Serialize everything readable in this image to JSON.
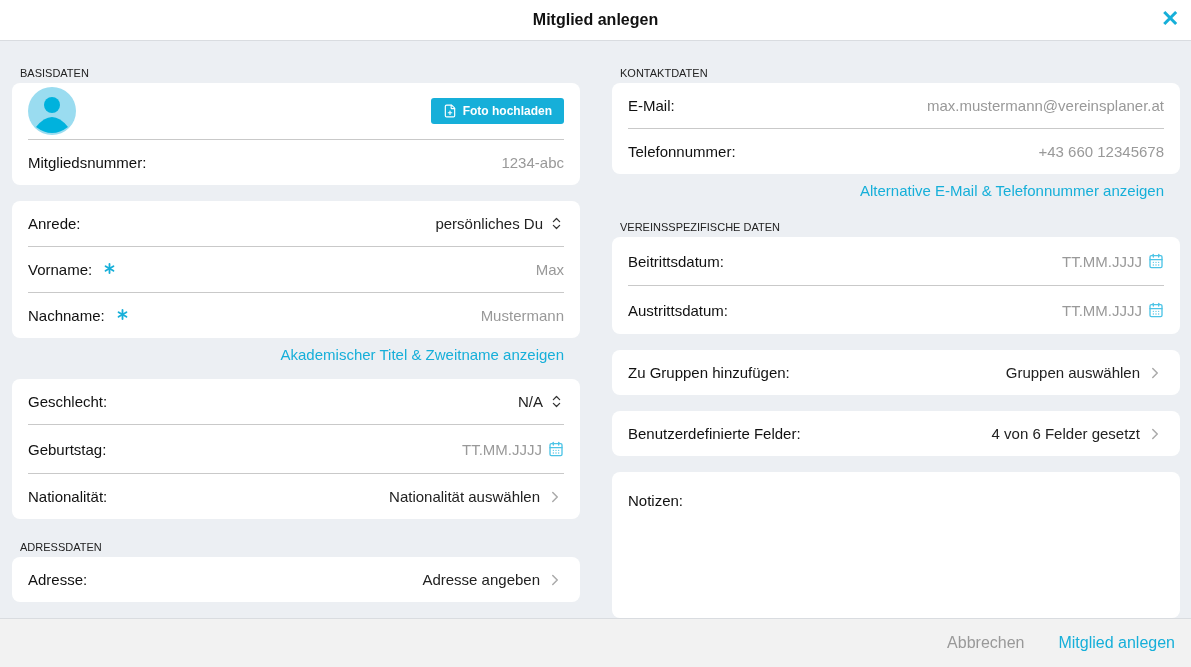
{
  "dialog": {
    "title": "Mitglied anlegen",
    "close": "✕"
  },
  "columns": [
    [
      {
        "kind": "heading",
        "text": "BASISDATEN"
      },
      {
        "kind": "card",
        "rows": [
          {
            "kind": "photo",
            "button": "Foto hochladen"
          },
          {
            "kind": "text",
            "label": "Mitgliedsnummer:",
            "required": false,
            "placeholder": "1234-abc"
          }
        ]
      },
      {
        "kind": "card",
        "rows": [
          {
            "kind": "select",
            "label": "Anrede:",
            "required": false,
            "value": "persönliches Du"
          },
          {
            "kind": "text",
            "label": "Vorname:",
            "required": true,
            "placeholder": "Max"
          },
          {
            "kind": "text",
            "label": "Nachname:",
            "required": true,
            "placeholder": "Mustermann"
          }
        ]
      },
      {
        "kind": "link",
        "text": "Akademischer Titel & Zweitname anzeigen"
      },
      {
        "kind": "card",
        "rows": [
          {
            "kind": "select",
            "label": "Geschlecht:",
            "required": false,
            "value": "N/A"
          },
          {
            "kind": "date",
            "label": "Geburtstag:",
            "required": false,
            "placeholder": "TT.MM.JJJJ"
          },
          {
            "kind": "nav",
            "label": "Nationalität:",
            "required": false,
            "value": "Nationalität auswählen"
          }
        ]
      },
      {
        "kind": "heading",
        "text": "ADRESSDATEN"
      },
      {
        "kind": "card",
        "rows": [
          {
            "kind": "nav",
            "label": "Adresse:",
            "required": false,
            "value": "Adresse angeben"
          }
        ]
      }
    ],
    [
      {
        "kind": "heading",
        "text": "KONTAKTDATEN"
      },
      {
        "kind": "card",
        "rows": [
          {
            "kind": "text",
            "label": "E-Mail:",
            "required": false,
            "placeholder": "max.mustermann@vereinsplaner.at"
          },
          {
            "kind": "text",
            "label": "Telefonnummer:",
            "required": false,
            "placeholder": "+43 660 12345678"
          }
        ]
      },
      {
        "kind": "link",
        "text": "Alternative E-Mail & Telefonnummer anzeigen"
      },
      {
        "kind": "heading",
        "text": "VEREINSSPEZIFISCHE DATEN"
      },
      {
        "kind": "card",
        "rows": [
          {
            "kind": "date",
            "label": "Beitrittsdatum:",
            "required": false,
            "placeholder": "TT.MM.JJJJ"
          },
          {
            "kind": "date",
            "label": "Austrittsdatum:",
            "required": false,
            "placeholder": "TT.MM.JJJJ"
          }
        ]
      },
      {
        "kind": "card",
        "rows": [
          {
            "kind": "nav",
            "label": "Zu Gruppen hinzufügen:",
            "required": false,
            "value": "Gruppen auswählen"
          }
        ]
      },
      {
        "kind": "card",
        "rows": [
          {
            "kind": "nav",
            "label": "Benutzerdefinierte Felder:",
            "required": false,
            "value": "4 von 6 Felder gesetzt"
          }
        ]
      },
      {
        "kind": "notes",
        "label": "Notizen:"
      }
    ]
  ],
  "footer": {
    "cancel": "Abbrechen",
    "submit": "Mitglied anlegen"
  }
}
